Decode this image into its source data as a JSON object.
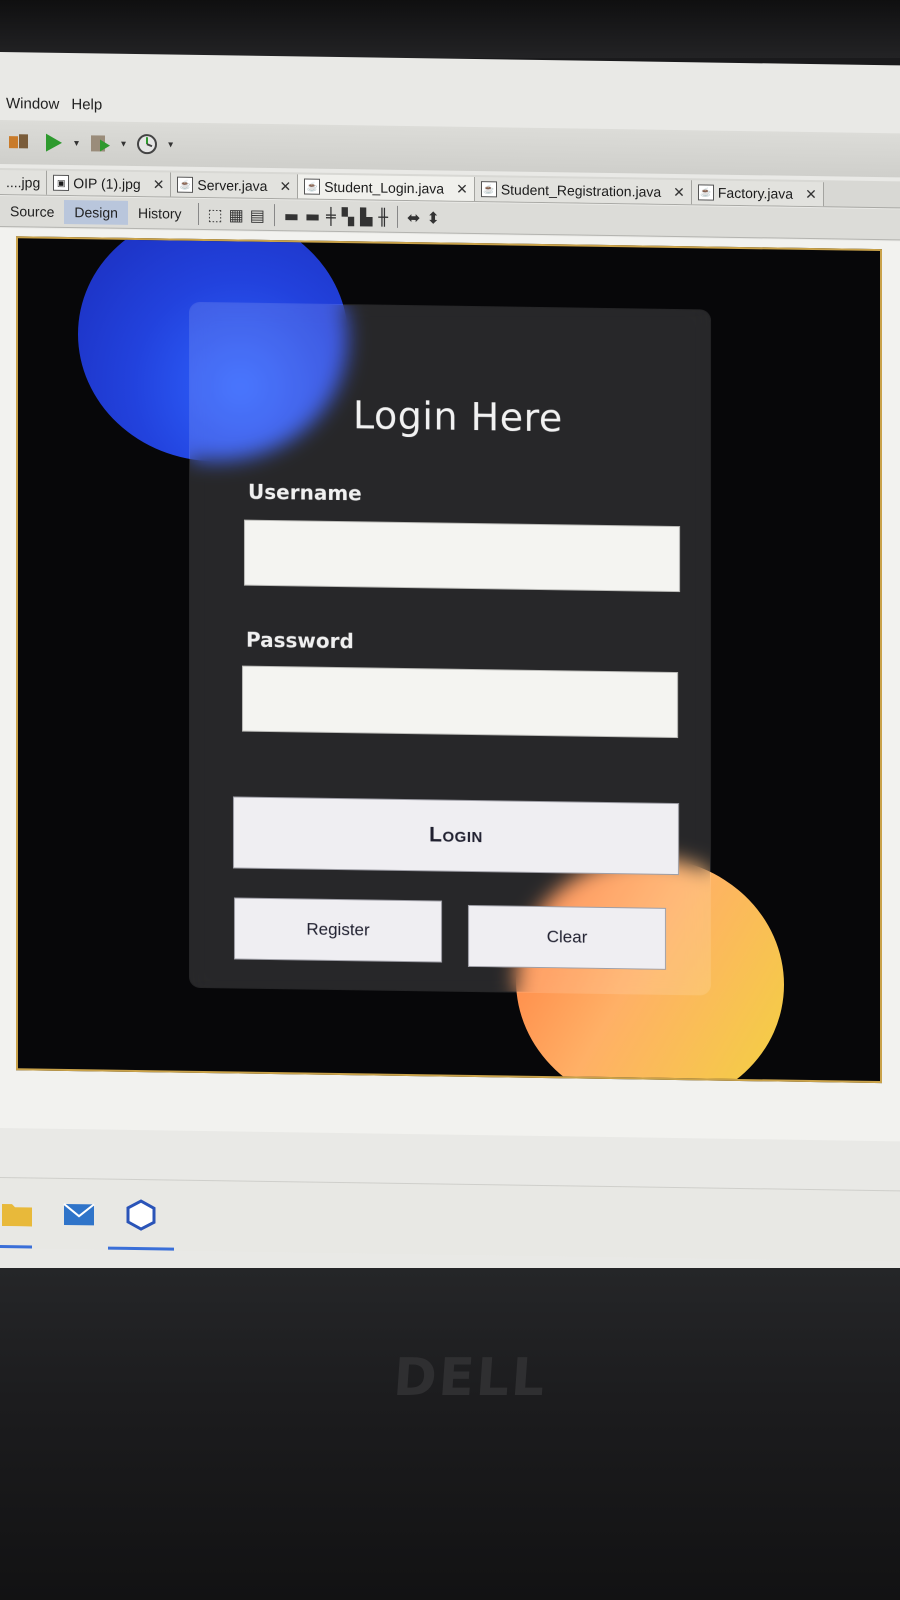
{
  "menu": [
    "Window",
    "Help"
  ],
  "toolbar_icons": [
    "project-icon",
    "run-icon",
    "build-icon",
    "profile-icon"
  ],
  "tabs": [
    {
      "label": "....jpg",
      "icon": "image-file-icon"
    },
    {
      "label": "OIP (1).jpg",
      "icon": "image-file-icon"
    },
    {
      "label": "Server.java",
      "icon": "java-file-icon"
    },
    {
      "label": "Student_Login.java",
      "icon": "java-file-icon",
      "active": true
    },
    {
      "label": "Student_Registration.java",
      "icon": "java-file-icon"
    },
    {
      "label": "Factory.java",
      "icon": "java-file-icon"
    }
  ],
  "views": {
    "source": "Source",
    "design": "Design",
    "history": "History"
  },
  "form": {
    "title": "Login Here",
    "username_label": "Username",
    "username_value": "",
    "password_label": "Password",
    "password_value": "",
    "login_label": "Login",
    "register_label": "Register",
    "clear_label": "Clear"
  },
  "colors": {
    "background": "#070709",
    "orb_blue": "#2242dd",
    "orb_orange": "#ffb066",
    "button_bg": "#efeef2"
  },
  "taskbar_icons": [
    "folder-icon",
    "mail-icon",
    "netbeans-icon"
  ],
  "monitor_brand": "DELL"
}
